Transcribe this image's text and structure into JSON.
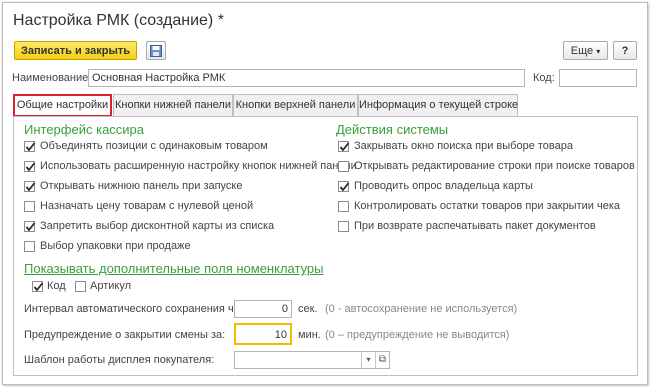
{
  "window": {
    "title": "Настройка РМК (создание) *"
  },
  "toolbar": {
    "write_close_label": "Записать и закрыть",
    "more_label": "Еще",
    "more_arrow": "▾",
    "help_label": "?"
  },
  "form": {
    "name_label": "Наименование:",
    "name_value": "Основная Настройка РМК",
    "code_label": "Код:",
    "code_value": ""
  },
  "tabs": [
    {
      "label": "Общие настройки",
      "active": true
    },
    {
      "label": "Кнопки нижней панели",
      "active": false
    },
    {
      "label": "Кнопки верхней панели",
      "active": false
    },
    {
      "label": "Информация о текущей строке",
      "active": false
    }
  ],
  "cashier": {
    "title": "Интерфейс кассира",
    "items": [
      {
        "label": "Объединять позиции с одинаковым товаром",
        "checked": true
      },
      {
        "label": "Использовать расширенную настройку кнопок нижней панели",
        "checked": true
      },
      {
        "label": "Открывать нижнюю панель при запуске",
        "checked": true
      },
      {
        "label": "Назначать цену товарам с нулевой ценой",
        "checked": false
      },
      {
        "label": "Запретить выбор дисконтной карты из списка",
        "checked": true
      },
      {
        "label": "Выбор упаковки при продаже",
        "checked": false
      }
    ]
  },
  "system": {
    "title": "Действия системы",
    "items": [
      {
        "label": "Закрывать окно поиска при выборе товара",
        "checked": true
      },
      {
        "label": "Открывать редактирование строки при поиске товаров",
        "checked": false
      },
      {
        "label": "Проводить опрос владельца карты",
        "checked": true
      },
      {
        "label": "Контролировать остатки товаров при закрытии чека",
        "checked": false
      },
      {
        "label": "При возврате распечатывать пакет документов",
        "checked": false
      }
    ]
  },
  "extra": {
    "title": "Показывать дополнительные поля номенклатуры",
    "items": [
      {
        "label": "Код",
        "checked": true
      },
      {
        "label": "Артикул",
        "checked": false
      }
    ]
  },
  "autosave": {
    "label": "Интервал автоматического сохранения чека:",
    "value": "0",
    "unit": "сек.",
    "note": "(0 - автосохранение не используется)"
  },
  "shift_warning": {
    "label": "Предупреждение о закрытии смены за:",
    "value": "10",
    "unit": "мин.",
    "note": "(0 – предупреждение не выводится)"
  },
  "display": {
    "label": "Шаблон работы дисплея покупателя:",
    "value": "",
    "open_icon": "⧉"
  },
  "colors": {
    "accent": "#f3cf13",
    "section": "#3a9e3a",
    "active_tab_border": "#d9232d",
    "focus": "#f5b800"
  }
}
